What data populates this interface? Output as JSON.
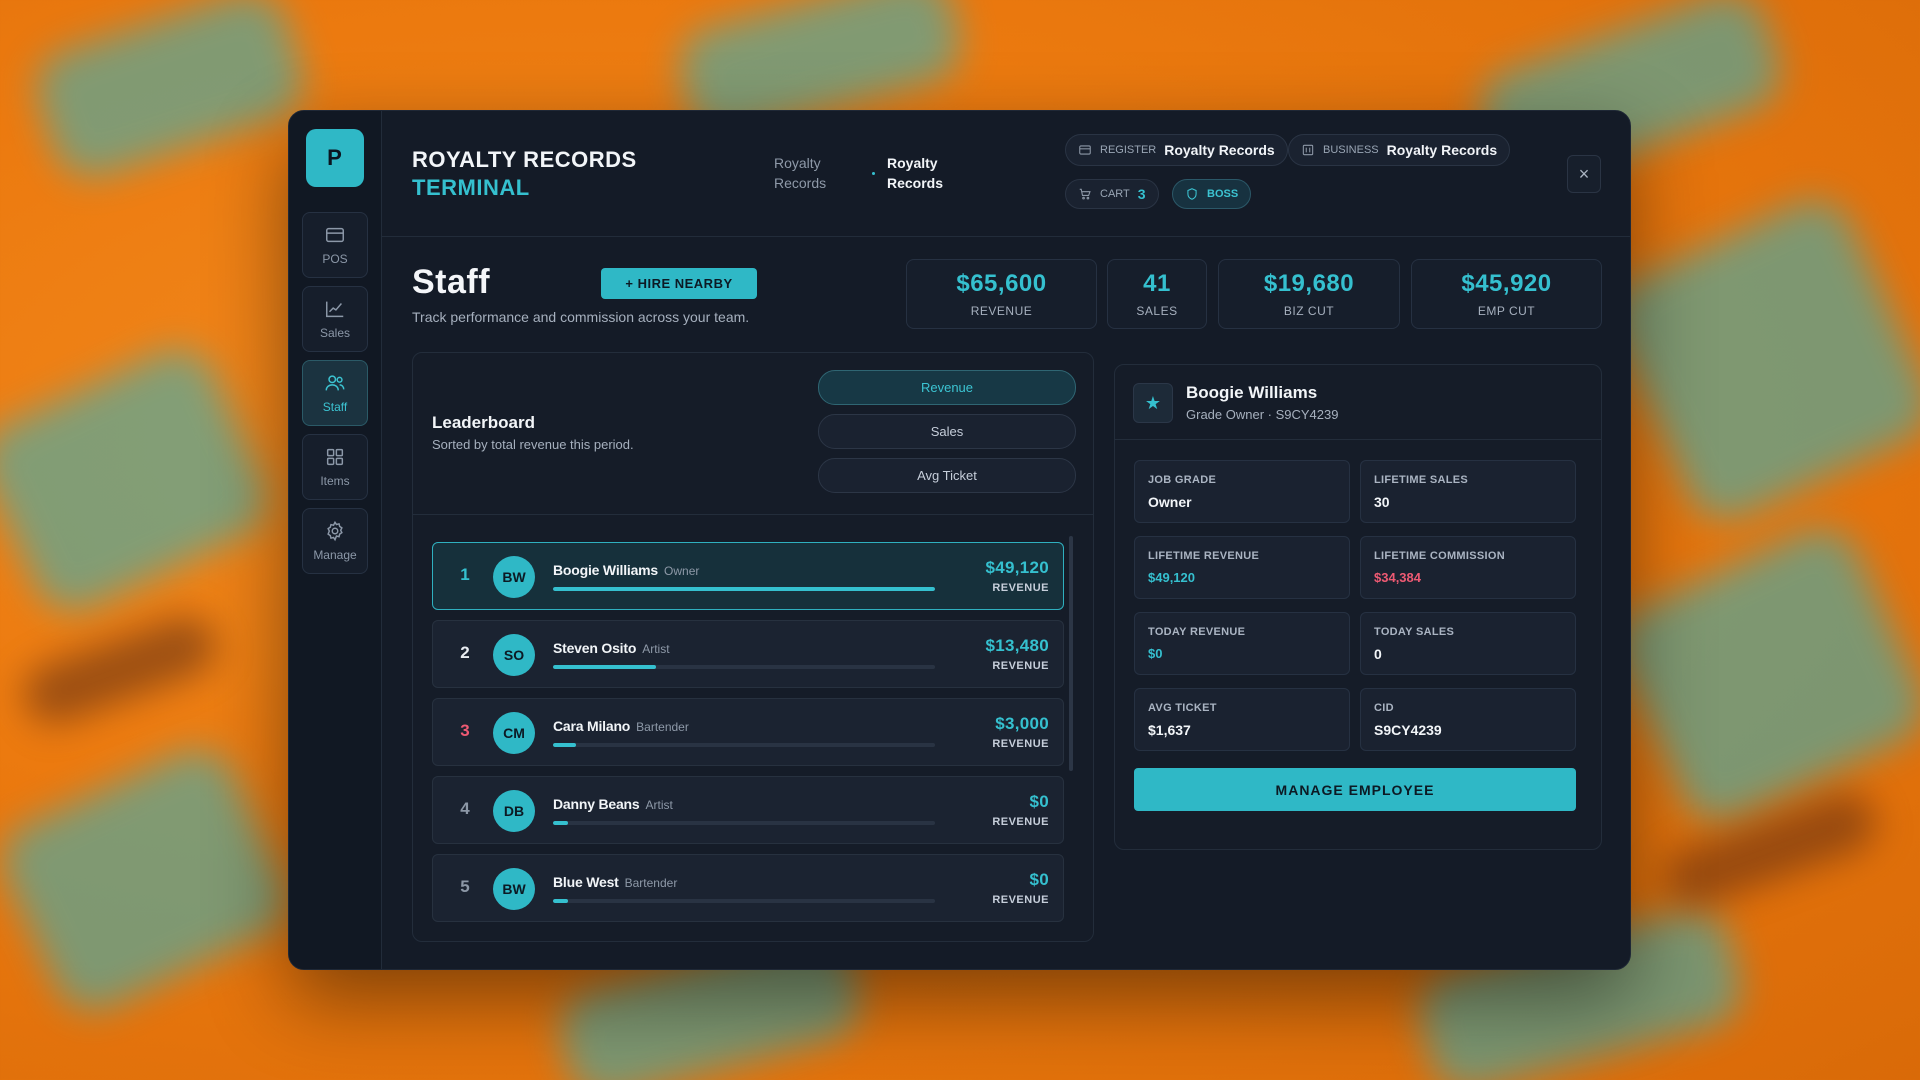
{
  "sidebar": {
    "logo": "P",
    "items": [
      {
        "label": "POS",
        "icon": "card-icon"
      },
      {
        "label": "Sales",
        "icon": "chart-icon"
      },
      {
        "label": "Staff",
        "icon": "users-icon",
        "active": true
      },
      {
        "label": "Items",
        "icon": "grid-icon"
      },
      {
        "label": "Manage",
        "icon": "gear-icon"
      }
    ]
  },
  "header": {
    "title_line1": "ROYALTY RECORDS",
    "title_line2": "TERMINAL",
    "breadcrumbs": [
      "Royalty Records",
      "Royalty Records"
    ],
    "register": {
      "label": "REGISTER",
      "value": "Royalty Records"
    },
    "business": {
      "label": "BUSINESS",
      "value": "Royalty Records"
    },
    "cart": {
      "label": "CART",
      "count": "3"
    },
    "boss_label": "BOSS",
    "close": "×"
  },
  "page": {
    "title": "Staff",
    "subtitle": "Track performance and commission across your team.",
    "hire_button": "+ HIRE NEARBY"
  },
  "stats": [
    {
      "value": "$65,600",
      "label": "REVENUE"
    },
    {
      "value": "41",
      "label": "SALES"
    },
    {
      "value": "$19,680",
      "label": "BIZ CUT"
    },
    {
      "value": "$45,920",
      "label": "EMP CUT"
    }
  ],
  "leaderboard": {
    "title": "Leaderboard",
    "subtitle": "Sorted by total revenue this period.",
    "sort_options": [
      "Revenue",
      "Sales",
      "Avg Ticket"
    ],
    "active_sort": "Revenue",
    "rows": [
      {
        "rank": "1",
        "initials": "BW",
        "name": "Boogie Williams",
        "role": "Owner",
        "value": "$49,120",
        "value_label": "REVENUE",
        "progress": 1.0
      },
      {
        "rank": "2",
        "initials": "SO",
        "name": "Steven Osito",
        "role": "Artist",
        "value": "$13,480",
        "value_label": "REVENUE",
        "progress": 0.27
      },
      {
        "rank": "3",
        "initials": "CM",
        "name": "Cara Milano",
        "role": "Bartender",
        "value": "$3,000",
        "value_label": "REVENUE",
        "progress": 0.06
      },
      {
        "rank": "4",
        "initials": "DB",
        "name": "Danny Beans",
        "role": "Artist",
        "value": "$0",
        "value_label": "REVENUE",
        "progress": 0.04
      },
      {
        "rank": "5",
        "initials": "BW",
        "name": "Blue West",
        "role": "Bartender",
        "value": "$0",
        "value_label": "REVENUE",
        "progress": 0.04
      }
    ]
  },
  "detail": {
    "name": "Boogie Williams",
    "subtitle": "Grade Owner · S9CY4239",
    "fields": [
      {
        "label": "JOB GRADE",
        "value": "Owner",
        "style": "plain"
      },
      {
        "label": "LIFETIME SALES",
        "value": "30",
        "style": "plain"
      },
      {
        "label": "LIFETIME REVENUE",
        "value": "$49,120",
        "style": "teal"
      },
      {
        "label": "LIFETIME COMMISSION",
        "value": "$34,384",
        "style": "red"
      },
      {
        "label": "TODAY REVENUE",
        "value": "$0",
        "style": "teal"
      },
      {
        "label": "TODAY SALES",
        "value": "0",
        "style": "plain"
      },
      {
        "label": "AVG TICKET",
        "value": "$1,637",
        "style": "plain"
      },
      {
        "label": "CID",
        "value": "S9CY4239",
        "style": "plain"
      }
    ],
    "manage_button": "MANAGE EMPLOYEE"
  },
  "colors": {
    "accent": "#2fb8c6",
    "danger": "#ee5a73",
    "background": "#141b27"
  }
}
